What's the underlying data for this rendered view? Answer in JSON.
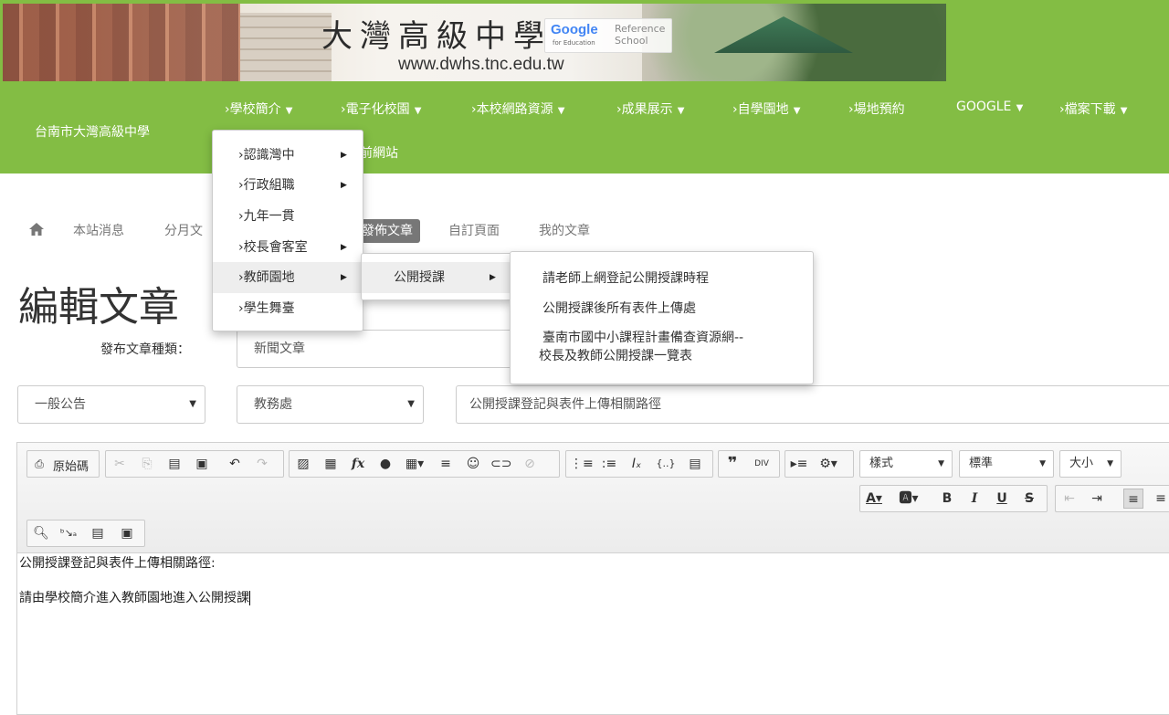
{
  "banner": {
    "school_name": "大灣高級中學",
    "url": "www.dwhs.tnc.edu.tw",
    "badge_google": "Google",
    "badge_for_education": "for Education",
    "badge_reference": "Reference School"
  },
  "navbar": {
    "brand": "台南市大灣高級中學",
    "items": [
      {
        "label": "›學校簡介",
        "dropdown": true
      },
      {
        "label": "›電子化校園",
        "dropdown": true
      },
      {
        "label": "›本校網路資源",
        "dropdown": true
      },
      {
        "label": "›成果展示",
        "dropdown": true
      },
      {
        "label": "›自學園地",
        "dropdown": true
      },
      {
        "label": "›場地預約",
        "dropdown": false
      },
      {
        "label": "GOOGLE",
        "dropdown": true
      },
      {
        "label": "›檔案下載",
        "dropdown": true
      }
    ],
    "row2_partial": "前網站"
  },
  "tabs": [
    {
      "label": "本站消息"
    },
    {
      "label": "分月文"
    },
    {
      "label": "發佈文章",
      "active": true
    },
    {
      "label": "自訂頁面"
    },
    {
      "label": "我的文章"
    }
  ],
  "page_title": "編輯文章",
  "form": {
    "category_label": "發布文章種類：",
    "category_value": "新聞文章",
    "select1": "一般公告",
    "select2": "教務處",
    "title_value": "公開授課登記與表件上傳相關路徑"
  },
  "editor": {
    "source_label": "原始碼",
    "style_combo": "樣式",
    "format_combo": "標準",
    "size_combo": "大小",
    "content_line1": "公開授課登記與表件上傳相關路徑:",
    "content_line2": "請由學校簡介進入教師園地進入公開授課"
  },
  "menu_level1": [
    {
      "label": "›認識灣中",
      "sub": true
    },
    {
      "label": "›行政組職",
      "sub": true
    },
    {
      "label": "›九年一貫",
      "sub": false
    },
    {
      "label": "›校長會客室",
      "sub": true
    },
    {
      "label": "›教師園地",
      "sub": true,
      "hover": true
    },
    {
      "label": "›學生舞臺",
      "sub": false
    }
  ],
  "menu_level2": [
    {
      "label": "公開授課",
      "sub": true,
      "hover": true
    }
  ],
  "menu_level3": [
    {
      "label": "請老師上網登記公開授課時程"
    },
    {
      "label": "公開授課後所有表件上傳處"
    },
    {
      "label_line1": "臺南市國中小課程計畫備查資源網--",
      "label_line2": "校長及教師公開授課一覽表"
    }
  ]
}
